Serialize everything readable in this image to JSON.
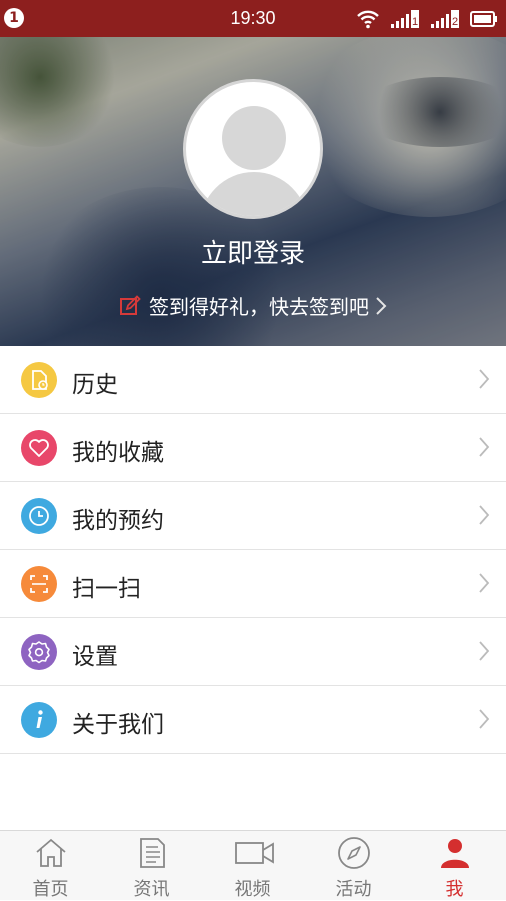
{
  "status_bar": {
    "notification_badge": "1",
    "time": "19:30",
    "sim1_label": "1",
    "sim2_label": "2"
  },
  "profile": {
    "login_label": "立即登录",
    "signin_prompt": "签到得好礼，快去签到吧"
  },
  "menu": {
    "items": [
      {
        "label": "历史",
        "icon": "history-icon",
        "color": "#f5c842"
      },
      {
        "label": "我的收藏",
        "icon": "heart-icon",
        "color": "#e8476a"
      },
      {
        "label": "我的预约",
        "icon": "clock-icon",
        "color": "#3fa9e0"
      },
      {
        "label": "扫一扫",
        "icon": "scan-icon",
        "color": "#f68a3a"
      },
      {
        "label": "设置",
        "icon": "gear-icon",
        "color": "#8e64c1"
      },
      {
        "label": "关于我们",
        "icon": "info-icon",
        "color": "#3fa9e0"
      }
    ]
  },
  "tabbar": {
    "tabs": [
      {
        "label": "首页",
        "icon": "home-icon"
      },
      {
        "label": "资讯",
        "icon": "document-icon"
      },
      {
        "label": "视频",
        "icon": "video-camera-icon"
      },
      {
        "label": "活动",
        "icon": "compass-icon"
      },
      {
        "label": "我",
        "icon": "user-icon",
        "active": true
      }
    ]
  },
  "colors": {
    "status_bar": "#8d1f1e",
    "accent": "#d42f2f"
  }
}
